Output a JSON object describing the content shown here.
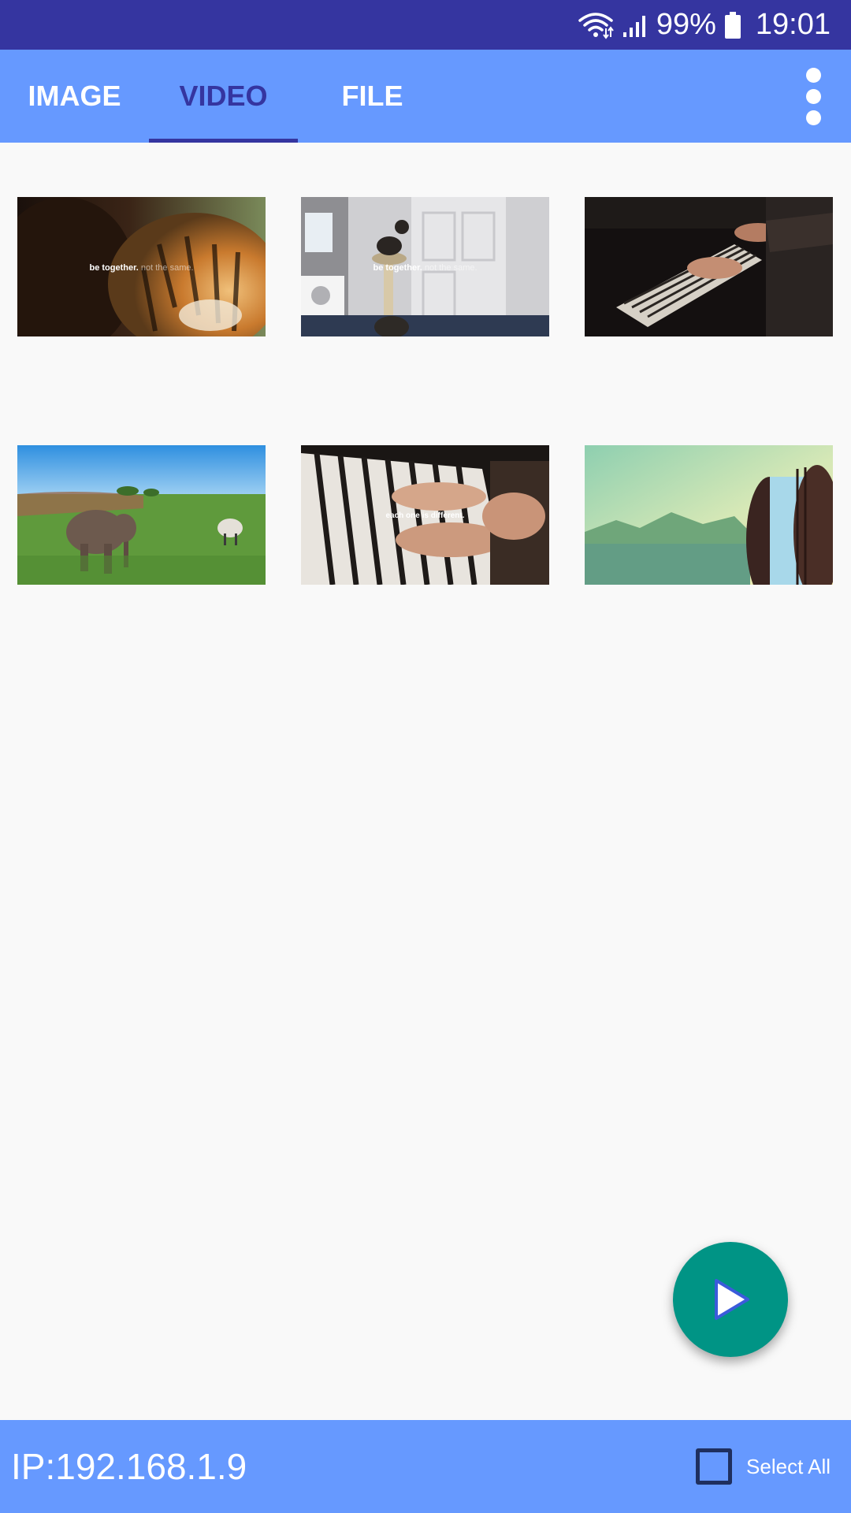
{
  "status_bar": {
    "battery": "99%",
    "time": "19:01",
    "icons": [
      "wifi-icon",
      "signal-icon",
      "battery-icon"
    ]
  },
  "tabs": [
    {
      "label": "IMAGE",
      "selected": false
    },
    {
      "label": "VIDEO",
      "selected": true
    },
    {
      "label": "FILE",
      "selected": false
    }
  ],
  "overflow_icon": "more-vert-icon",
  "videos": [
    {
      "scene": "bear and tiger",
      "caption_main": "be together.",
      "caption_dim": "not the same."
    },
    {
      "scene": "cat and dog in kitchen",
      "caption_main": "be together.",
      "caption_dim": "not the same."
    },
    {
      "scene": "hands playing keyboard in dark",
      "caption_main": "",
      "caption_dim": ""
    },
    {
      "scene": "elephant and sheep in field",
      "caption_main": "",
      "caption_dim": ""
    },
    {
      "scene": "hands on piano keys",
      "caption_main": "each one is different.",
      "caption_dim": ""
    },
    {
      "scene": "cookie over landscape",
      "caption_main": "",
      "caption_dim": ""
    }
  ],
  "fab_icon": "play-icon",
  "bottom_bar": {
    "ip": "IP:192.168.1.9",
    "select_all_label": "Select All",
    "select_all_checked": false
  },
  "colors": {
    "status_bar": "#3535a0",
    "app_bar": "#6699ff",
    "selected_tab": "#3535a0",
    "fab": "#009485",
    "background": "#f9f9f9"
  }
}
